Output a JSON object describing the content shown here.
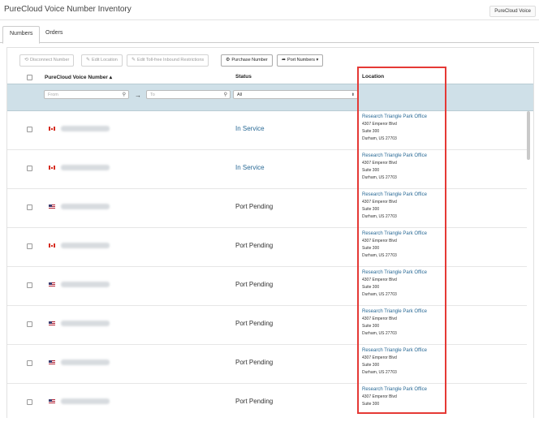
{
  "app": {
    "title": "PureCloud Voice Number Inventory",
    "top_button": "PureCloud Voice"
  },
  "tabs": [
    {
      "label": "Numbers",
      "active": true
    },
    {
      "label": "Orders",
      "active": false
    }
  ],
  "toolbar": {
    "disconnect": "Disconnect Number",
    "edit_location": "Edit Location",
    "edit_tollfree": "Edit Toll-free Inbound Restrictions",
    "purchase": "Purchase Number",
    "port": "Port Numbers"
  },
  "columns": {
    "number": "PureCloud Voice Number",
    "status": "Status",
    "location": "Location"
  },
  "filters": {
    "from_placeholder": "From",
    "to_placeholder": "To",
    "status_value": "All"
  },
  "rows": [
    {
      "flag": "ca",
      "status": "In Service",
      "location": {
        "name": "Research Triangle Park Office",
        "line1": "4307 Emperor Blvd",
        "line2": "Suite 300",
        "line3": "Durham, US 27703"
      }
    },
    {
      "flag": "ca",
      "status": "In Service",
      "location": {
        "name": "Research Triangle Park Office",
        "line1": "4307 Emperor Blvd",
        "line2": "Suite 300",
        "line3": "Durham, US 27703"
      }
    },
    {
      "flag": "us",
      "status": "Port Pending",
      "location": {
        "name": "Research Triangle Park Office",
        "line1": "4307 Emperor Blvd",
        "line2": "Suite 300",
        "line3": "Durham, US 27703"
      }
    },
    {
      "flag": "ca",
      "status": "Port Pending",
      "location": {
        "name": "Research Triangle Park Office",
        "line1": "4307 Emperor Blvd",
        "line2": "Suite 300",
        "line3": "Durham, US 27703"
      }
    },
    {
      "flag": "us",
      "status": "Port Pending",
      "location": {
        "name": "Research Triangle Park Office",
        "line1": "4307 Emperor Blvd",
        "line2": "Suite 300",
        "line3": "Durham, US 27703"
      }
    },
    {
      "flag": "us",
      "status": "Port Pending",
      "location": {
        "name": "Research Triangle Park Office",
        "line1": "4307 Emperor Blvd",
        "line2": "Suite 300",
        "line3": "Durham, US 27703"
      }
    },
    {
      "flag": "us",
      "status": "Port Pending",
      "location": {
        "name": "Research Triangle Park Office",
        "line1": "4307 Emperor Blvd",
        "line2": "Suite 300",
        "line3": "Durham, US 27703"
      }
    },
    {
      "flag": "us",
      "status": "Port Pending",
      "location": {
        "name": "Research Triangle Park Office",
        "line1": "4307 Emperor Blvd",
        "line2": "Suite 300",
        "line3": ""
      }
    }
  ],
  "colors": {
    "link": "#2a6a96",
    "filter_bg": "#cfe0e8",
    "highlight": "#e53935"
  },
  "icons": {
    "sort": "sort-ascending-icon",
    "search": "search-icon",
    "arrow": "arrow-right-icon"
  }
}
